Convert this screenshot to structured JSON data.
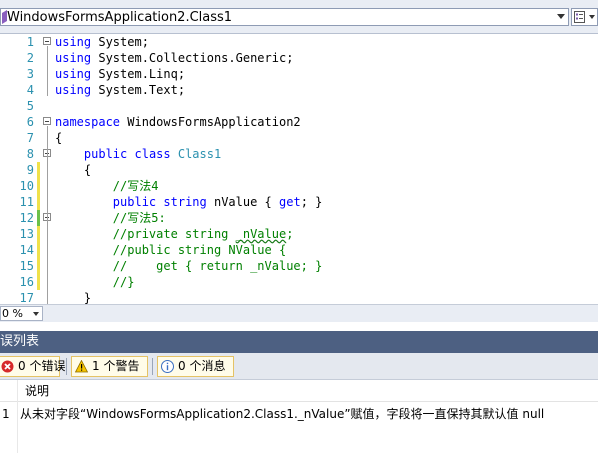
{
  "nav": {
    "class_selector": "WindowsFormsApplication2.Class1"
  },
  "editor": {
    "lines": [
      {
        "n": "1",
        "tokens": [
          {
            "t": "using",
            "c": "kw"
          },
          {
            "t": " System;",
            "c": ""
          }
        ]
      },
      {
        "n": "2",
        "tokens": [
          {
            "t": "using",
            "c": "kw"
          },
          {
            "t": " System.Collections.Generic;",
            "c": ""
          }
        ]
      },
      {
        "n": "3",
        "tokens": [
          {
            "t": "using",
            "c": "kw"
          },
          {
            "t": " System.Linq;",
            "c": ""
          }
        ]
      },
      {
        "n": "4",
        "tokens": [
          {
            "t": "using",
            "c": "kw"
          },
          {
            "t": " System.Text;",
            "c": ""
          }
        ]
      },
      {
        "n": "5",
        "tokens": []
      },
      {
        "n": "6",
        "tokens": [
          {
            "t": "namespace",
            "c": "kw"
          },
          {
            "t": " WindowsFormsApplication2",
            "c": ""
          }
        ]
      },
      {
        "n": "7",
        "tokens": [
          {
            "t": "{",
            "c": ""
          }
        ]
      },
      {
        "n": "8",
        "tokens": [
          {
            "t": "    ",
            "c": ""
          },
          {
            "t": "public",
            "c": "kw"
          },
          {
            "t": " ",
            "c": ""
          },
          {
            "t": "class",
            "c": "kw"
          },
          {
            "t": " ",
            "c": ""
          },
          {
            "t": "Class1",
            "c": "ty"
          }
        ]
      },
      {
        "n": "9",
        "tokens": [
          {
            "t": "    {",
            "c": ""
          }
        ]
      },
      {
        "n": "10",
        "tokens": [
          {
            "t": "        ",
            "c": ""
          },
          {
            "t": "//写法4",
            "c": "cm"
          }
        ]
      },
      {
        "n": "11",
        "tokens": [
          {
            "t": "        ",
            "c": ""
          },
          {
            "t": "public",
            "c": "kw"
          },
          {
            "t": " ",
            "c": ""
          },
          {
            "t": "string",
            "c": "kw"
          },
          {
            "t": " nValue { ",
            "c": ""
          },
          {
            "t": "get",
            "c": "kw"
          },
          {
            "t": "; }",
            "c": ""
          }
        ]
      },
      {
        "n": "12",
        "tokens": [
          {
            "t": "        ",
            "c": ""
          },
          {
            "t": "//写法5:",
            "c": "cm"
          }
        ]
      },
      {
        "n": "13",
        "tokens": [
          {
            "t": "        ",
            "c": ""
          },
          {
            "t": "//private string ",
            "c": "cm"
          },
          {
            "t": "_nValue",
            "c": "cm sq"
          },
          {
            "t": ";",
            "c": "cm"
          }
        ]
      },
      {
        "n": "14",
        "tokens": [
          {
            "t": "        ",
            "c": ""
          },
          {
            "t": "//public string NValue {",
            "c": "cm"
          }
        ]
      },
      {
        "n": "15",
        "tokens": [
          {
            "t": "        ",
            "c": ""
          },
          {
            "t": "//    get { return _nValue; }",
            "c": "cm"
          }
        ]
      },
      {
        "n": "16",
        "tokens": [
          {
            "t": "        ",
            "c": ""
          },
          {
            "t": "//}",
            "c": "cm"
          }
        ]
      },
      {
        "n": "17",
        "tokens": [
          {
            "t": "    }",
            "c": ""
          }
        ]
      }
    ]
  },
  "zoom": {
    "value": "0 %"
  },
  "error_list": {
    "title": "误列表",
    "filters": {
      "errors": "0 个错误",
      "warnings": "1 个警告",
      "messages": "0 个消息"
    },
    "column_description": "说明",
    "rows": [
      {
        "num": "1",
        "message": "从未对字段“WindowsFormsApplication2.Class1._nValue”赋值，字段将一直保持其默认值 null"
      }
    ]
  }
}
